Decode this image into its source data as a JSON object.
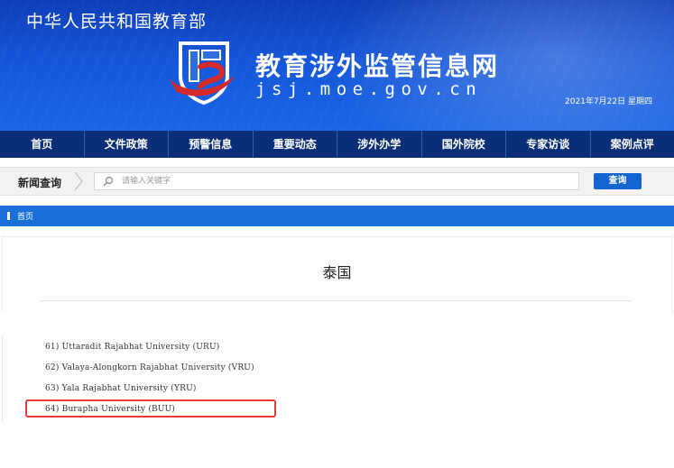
{
  "header": {
    "ministry_name": "中华人民共和国教育部",
    "site_title": "教育涉外监管信息网",
    "site_domain": "jsj.moe.gov.cn",
    "date_text": "2021年7月22日 星期四",
    "colors": {
      "banner": "#1556d8",
      "nav": "#0a2f78",
      "logo_red": "#d62a2a"
    }
  },
  "nav": {
    "items": [
      {
        "label": "首页"
      },
      {
        "label": "文件政策"
      },
      {
        "label": "预警信息"
      },
      {
        "label": "重要动态"
      },
      {
        "label": "涉外办学"
      },
      {
        "label": "国外院校"
      },
      {
        "label": "专家访谈"
      },
      {
        "label": "案例点评"
      }
    ]
  },
  "search": {
    "label": "新闻查询",
    "placeholder": "请输入关键字",
    "value": "",
    "button_label": "查询",
    "icon": "search-icon"
  },
  "breadcrumb": {
    "home_label": "首页"
  },
  "article": {
    "title": "泰国"
  },
  "list": {
    "items": [
      {
        "text": "61) Uttaradit Rajabhat University (URU)"
      },
      {
        "text": "62) Valaya-Alongkorn Rajabhat University (VRU)"
      },
      {
        "text": "63) Yala Rajabhat University (YRU)"
      },
      {
        "text": "64) Burapha University (BUU)",
        "highlighted": true
      }
    ],
    "highlight_color": "#e23b3b"
  }
}
